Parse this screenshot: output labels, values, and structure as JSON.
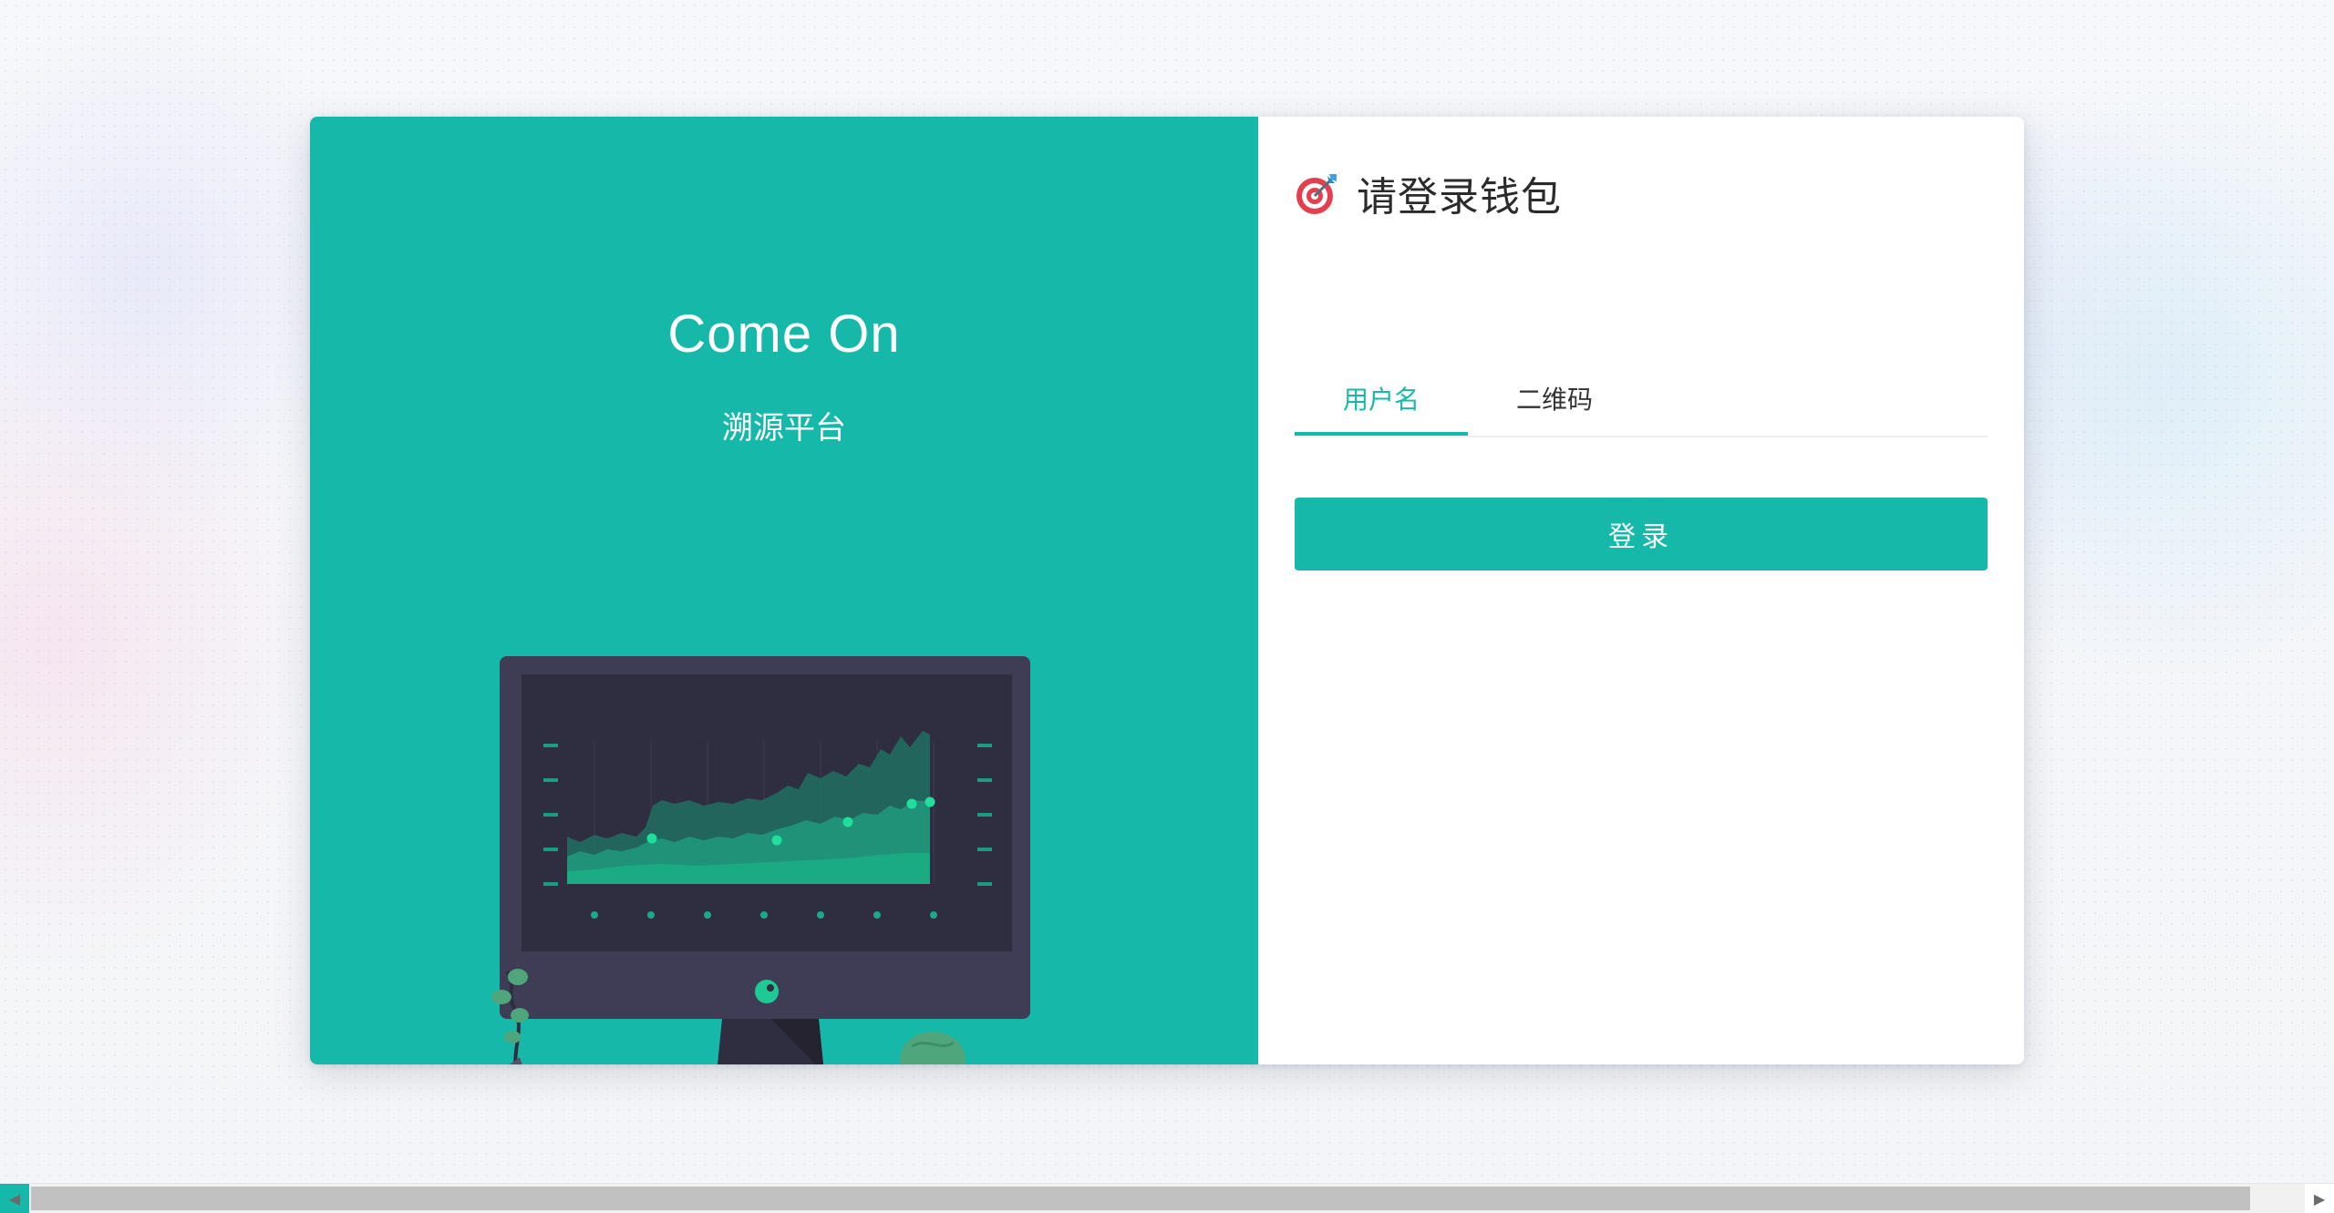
{
  "welcome": {
    "title": "Come On",
    "subtitle": "溯源平台"
  },
  "login": {
    "heading_icon": "target-icon",
    "heading": "请登录钱包",
    "tabs": [
      {
        "label": "用户名",
        "active": true
      },
      {
        "label": "二维码",
        "active": false
      }
    ],
    "submit_label": "登录"
  },
  "colors": {
    "accent": "#16b9a9",
    "monitor_frame": "#3f3d56",
    "monitor_screen": "#2f2e41"
  },
  "scrollbar": {
    "left_arrow_icon": "arrow-left-icon",
    "right_arrow_icon": "arrow-right-icon"
  }
}
